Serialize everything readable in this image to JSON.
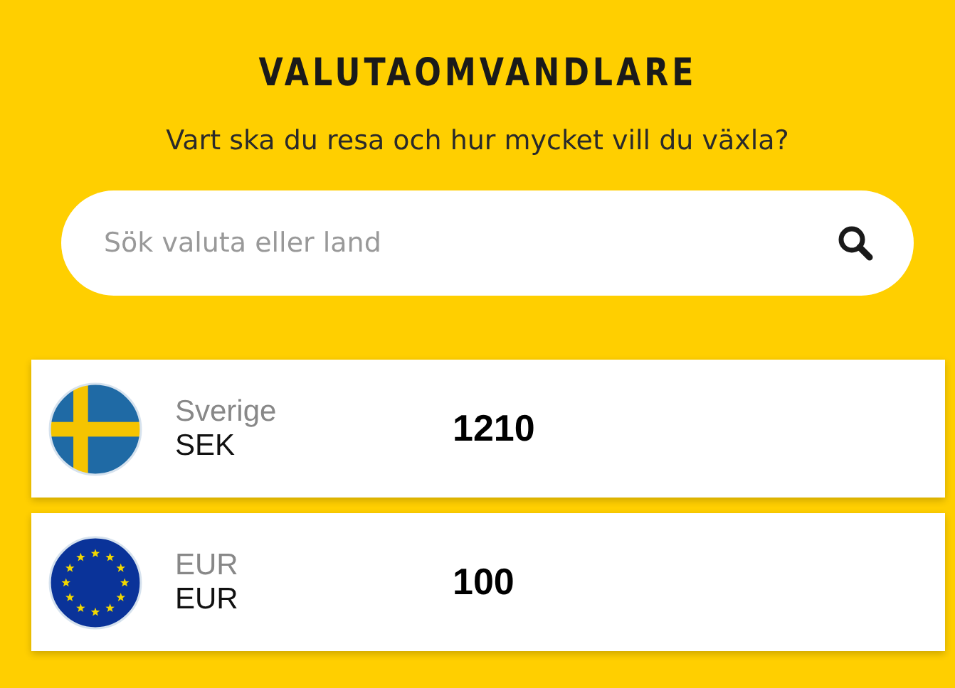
{
  "title": "VALUTAOMVANDLARE",
  "subtitle": "Vart ska du resa och hur mycket vill du växla?",
  "search": {
    "placeholder": "Sök valuta eller land"
  },
  "currencies": [
    {
      "kind": "swedish",
      "name": "Sverige",
      "code": "SEK",
      "amount": "1210"
    },
    {
      "kind": "european",
      "name": "EUR",
      "code": "EUR",
      "amount": "100"
    }
  ]
}
